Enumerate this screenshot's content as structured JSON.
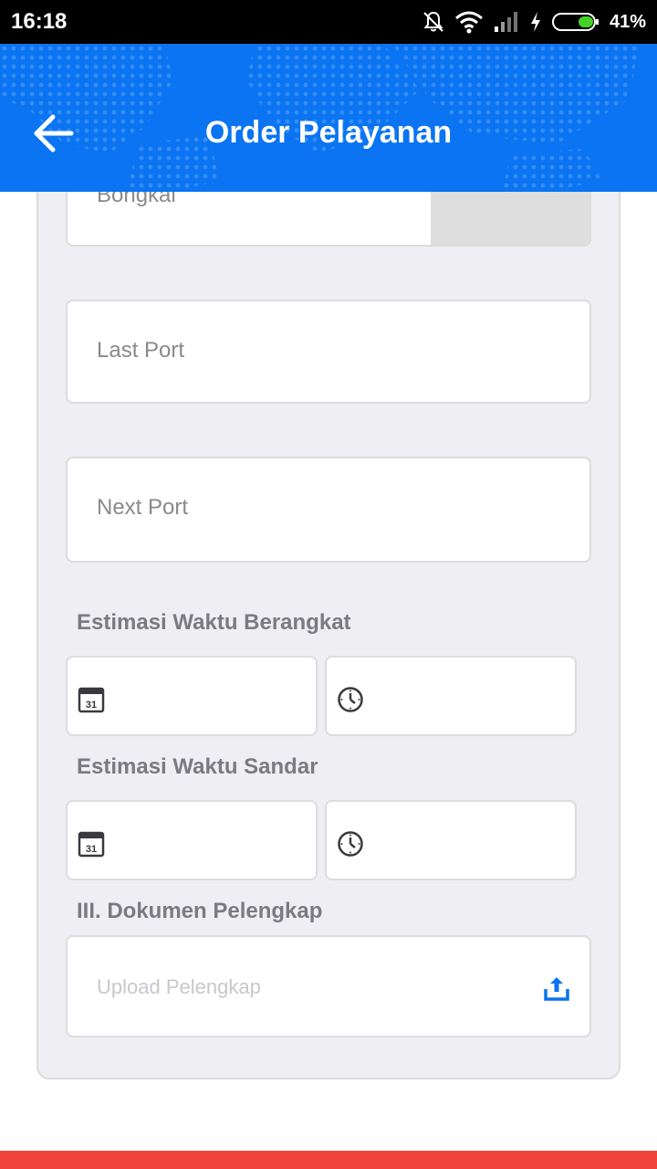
{
  "status_bar": {
    "time": "16:18",
    "battery_percent": "41%",
    "icons": [
      "bell-off-icon",
      "wifi-icon",
      "signal-icon",
      "charging-bolt-icon",
      "battery-icon"
    ]
  },
  "app_bar": {
    "title": "Order Pelayanan",
    "back_icon": "arrow-left-icon",
    "color": "#0a74f2"
  },
  "form": {
    "bongkai_label": "Bongkai",
    "last_port_placeholder": "Last Port",
    "next_port_placeholder": "Next Port",
    "departure_label": "Estimasi Waktu Berangkat",
    "berth_label": "Estimasi Waktu Sandar",
    "calendar_icon_text": "31",
    "documents_label": "III. Dokumen Pelengkap",
    "upload_placeholder": "Upload Pelengkap"
  },
  "colors": {
    "accent": "#0a74f2",
    "bottom_bar": "#f0443a",
    "label": "#7a7a80"
  }
}
